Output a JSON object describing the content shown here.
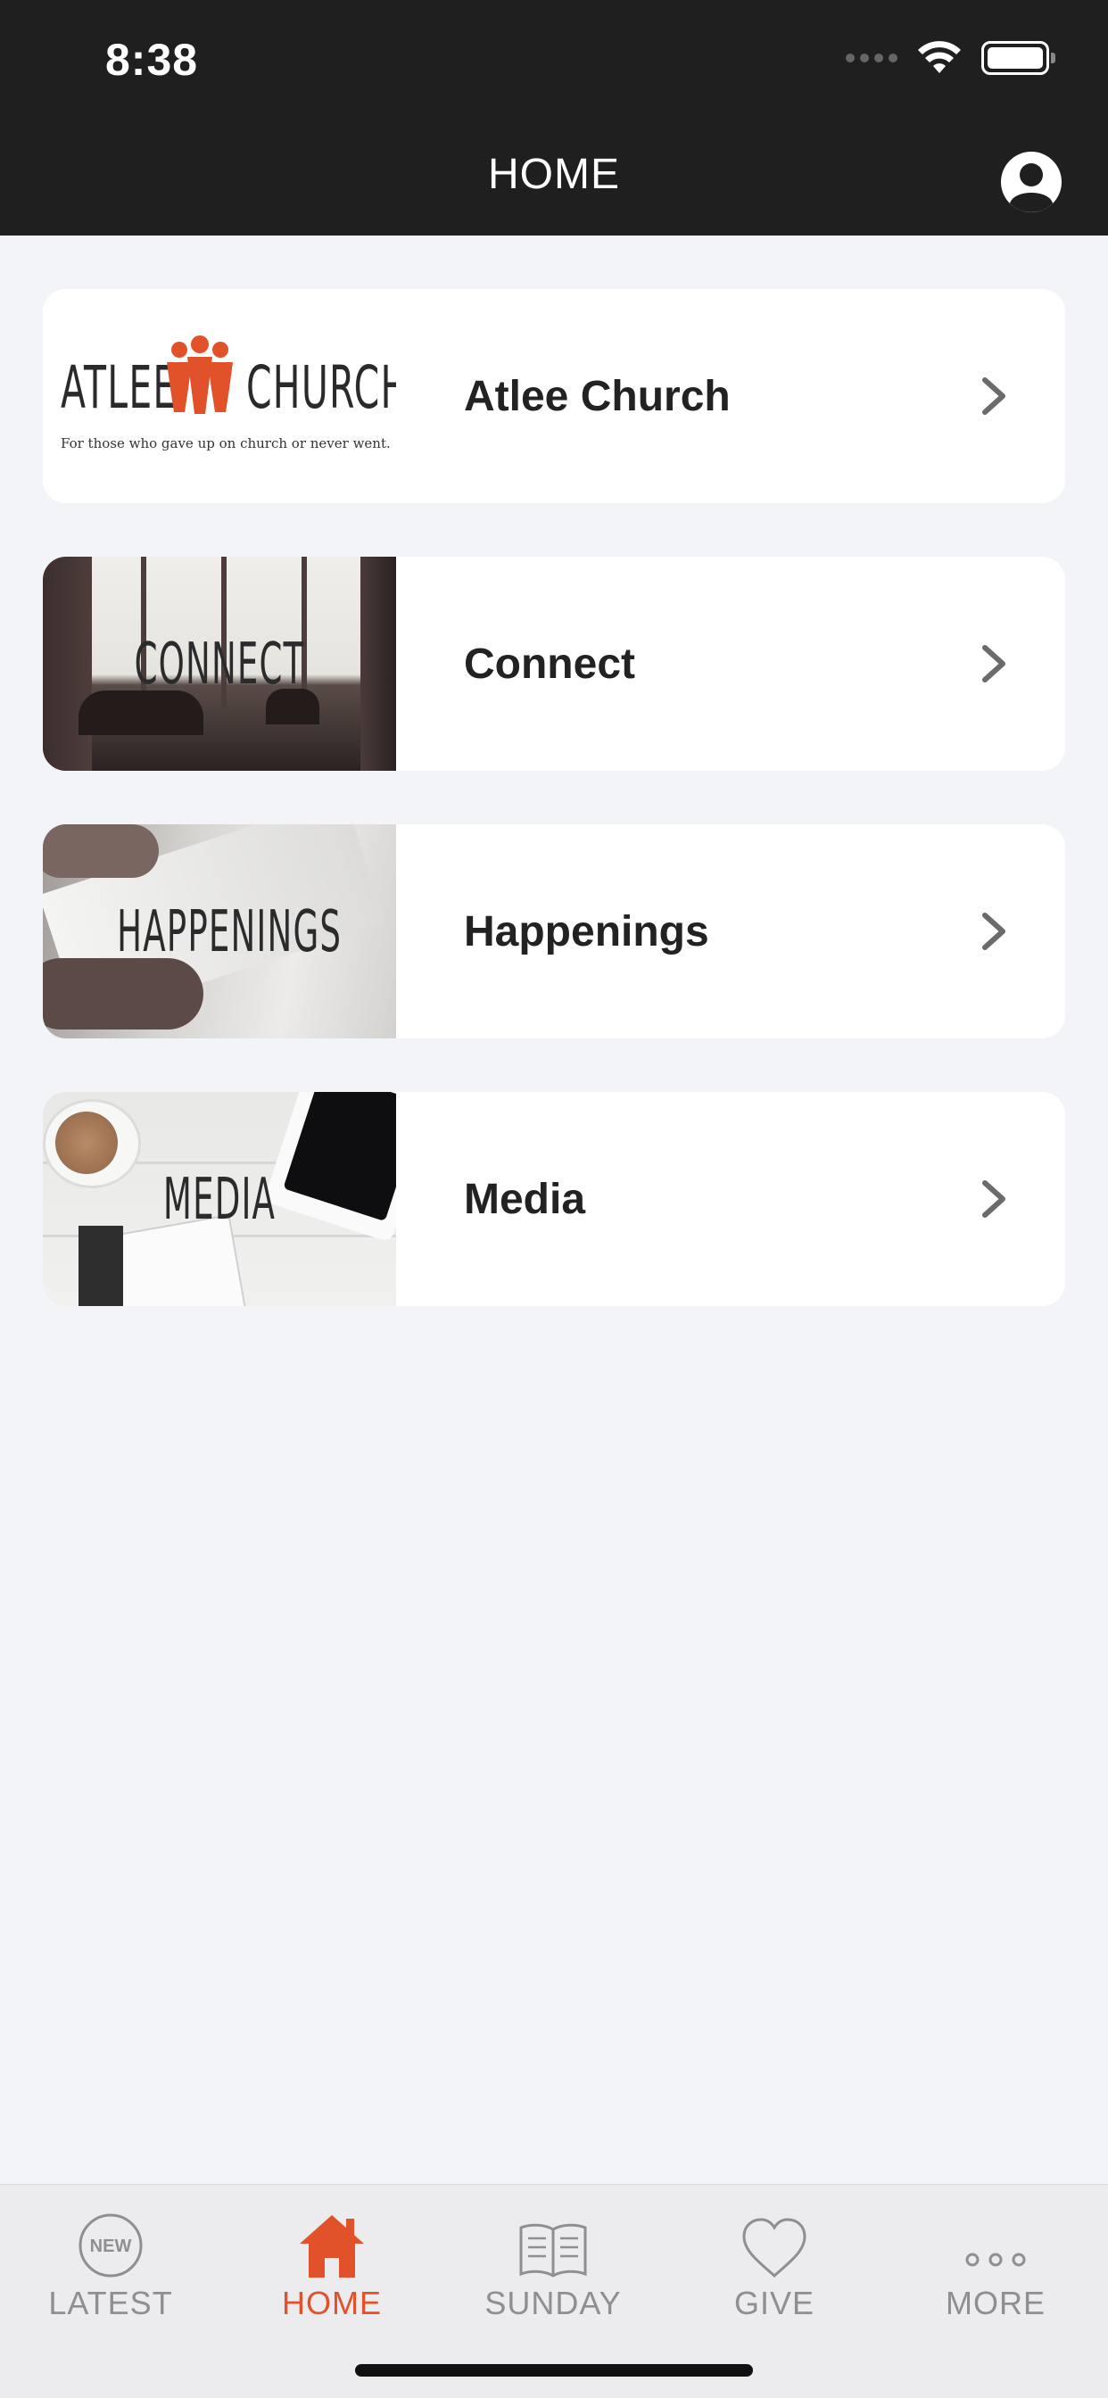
{
  "status_bar": {
    "time": "8:38"
  },
  "header": {
    "title": "HOME"
  },
  "cards": [
    {
      "label": "Atlee Church",
      "logo_left": "ATLEE",
      "logo_right": "CHURCH",
      "tagline": "For those who gave up on church or never went."
    },
    {
      "label": "Connect",
      "thumb_text": "CONNECT"
    },
    {
      "label": "Happenings",
      "thumb_text": "HAPPENINGS"
    },
    {
      "label": "Media",
      "thumb_text": "MEDIA"
    }
  ],
  "tabbar": {
    "items": [
      {
        "label": "LATEST",
        "icon": "new-badge-icon",
        "badge": "NEW"
      },
      {
        "label": "HOME",
        "icon": "house-icon",
        "active": true
      },
      {
        "label": "SUNDAY",
        "icon": "open-book-icon"
      },
      {
        "label": "GIVE",
        "icon": "heart-icon"
      },
      {
        "label": "MORE",
        "icon": "more-dots-icon"
      }
    ]
  },
  "colors": {
    "accent": "#e2522a",
    "header_bg": "#1f1f1f",
    "page_bg": "#f3f4f8",
    "tab_inactive": "#8e8e93"
  }
}
